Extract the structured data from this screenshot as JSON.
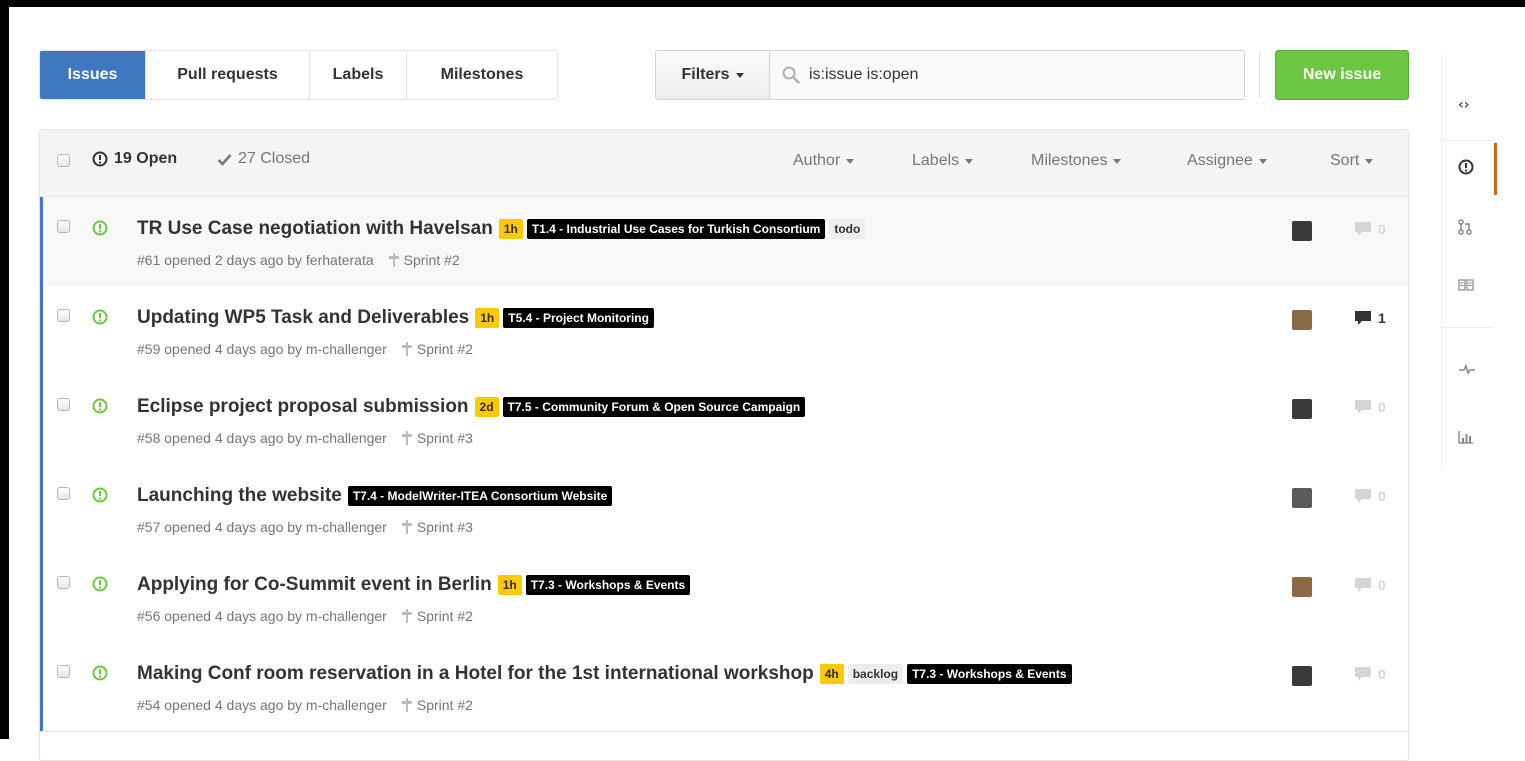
{
  "subnav": {
    "tabs": [
      {
        "label": "Issues",
        "active": true
      },
      {
        "label": "Pull requests",
        "active": false
      },
      {
        "label": "Labels",
        "active": false
      },
      {
        "label": "Milestones",
        "active": false
      }
    ]
  },
  "filters": {
    "button_label": "Filters",
    "search_value": "is:issue is:open"
  },
  "new_issue_label": "New issue",
  "header": {
    "open_count": "19 Open",
    "closed_count": "27 Closed",
    "filters": [
      "Author",
      "Labels",
      "Milestones",
      "Assignee",
      "Sort"
    ]
  },
  "issues": [
    {
      "title": "TR Use Case negotiation with Havelsan",
      "labels": [
        {
          "text": "1h",
          "bg": "#fbca04",
          "fg": "#332900"
        },
        {
          "text": "T1.4 - Industrial Use Cases for Turkish Consortium",
          "bg": "#000000",
          "fg": "#ffffff"
        },
        {
          "text": "todo",
          "bg": "#ededed",
          "fg": "#333333"
        }
      ],
      "meta_prefix": "#61 opened 2 days ago by",
      "author": "ferhaterata",
      "milestone": "Sprint #2",
      "comments": "0",
      "has_comments": false,
      "avatar_color": "#3a3a3a"
    },
    {
      "title": "Updating WP5 Task and Deliverables",
      "labels": [
        {
          "text": "1h",
          "bg": "#fbca04",
          "fg": "#332900"
        },
        {
          "text": "T5.4 - Project Monitoring",
          "bg": "#000000",
          "fg": "#ffffff"
        }
      ],
      "meta_prefix": "#59 opened 4 days ago by",
      "author": "m-challenger",
      "milestone": "Sprint #2",
      "comments": "1",
      "has_comments": true,
      "avatar_color": "#8a6a45"
    },
    {
      "title": "Eclipse project proposal submission",
      "labels": [
        {
          "text": "2d",
          "bg": "#fbca04",
          "fg": "#332900"
        },
        {
          "text": "T7.5 - Community Forum & Open Source Campaign",
          "bg": "#000000",
          "fg": "#ffffff"
        }
      ],
      "meta_prefix": "#58 opened 4 days ago by",
      "author": "m-challenger",
      "milestone": "Sprint #3",
      "comments": "0",
      "has_comments": false,
      "avatar_color": "#3a3a3a"
    },
    {
      "title": "Launching the website",
      "labels": [
        {
          "text": "T7.4 - ModelWriter-ITEA Consortium Website",
          "bg": "#000000",
          "fg": "#ffffff"
        }
      ],
      "meta_prefix": "#57 opened 4 days ago by",
      "author": "m-challenger",
      "milestone": "Sprint #3",
      "comments": "0",
      "has_comments": false,
      "avatar_color": "#5a5a5a"
    },
    {
      "title": "Applying for Co-Summit event in Berlin",
      "labels": [
        {
          "text": "1h",
          "bg": "#fbca04",
          "fg": "#332900"
        },
        {
          "text": "T7.3 - Workshops & Events",
          "bg": "#000000",
          "fg": "#ffffff"
        }
      ],
      "meta_prefix": "#56 opened 4 days ago by",
      "author": "m-challenger",
      "milestone": "Sprint #2",
      "comments": "0",
      "has_comments": false,
      "avatar_color": "#8a6a45"
    },
    {
      "title": "Making Conf room reservation in a Hotel for the 1st international workshop",
      "labels": [
        {
          "text": "4h",
          "bg": "#fbca04",
          "fg": "#332900"
        },
        {
          "text": "backlog",
          "bg": "#ededed",
          "fg": "#333333"
        },
        {
          "text": "T7.3 - Workshops & Events",
          "bg": "#000000",
          "fg": "#ffffff"
        }
      ],
      "meta_prefix": "#54 opened 4 days ago by",
      "author": "m-challenger",
      "milestone": "Sprint #2",
      "comments": "0",
      "has_comments": false,
      "avatar_color": "#3a3a3a"
    }
  ],
  "colors": {
    "accent": "#4078c0",
    "open_green": "#6cc644",
    "sidebar_active": "#d26911"
  },
  "right_nav": [
    "code-icon",
    "issue-opened-icon",
    "git-pull-request-icon",
    "book-icon",
    "pulse-icon",
    "graph-icon"
  ]
}
